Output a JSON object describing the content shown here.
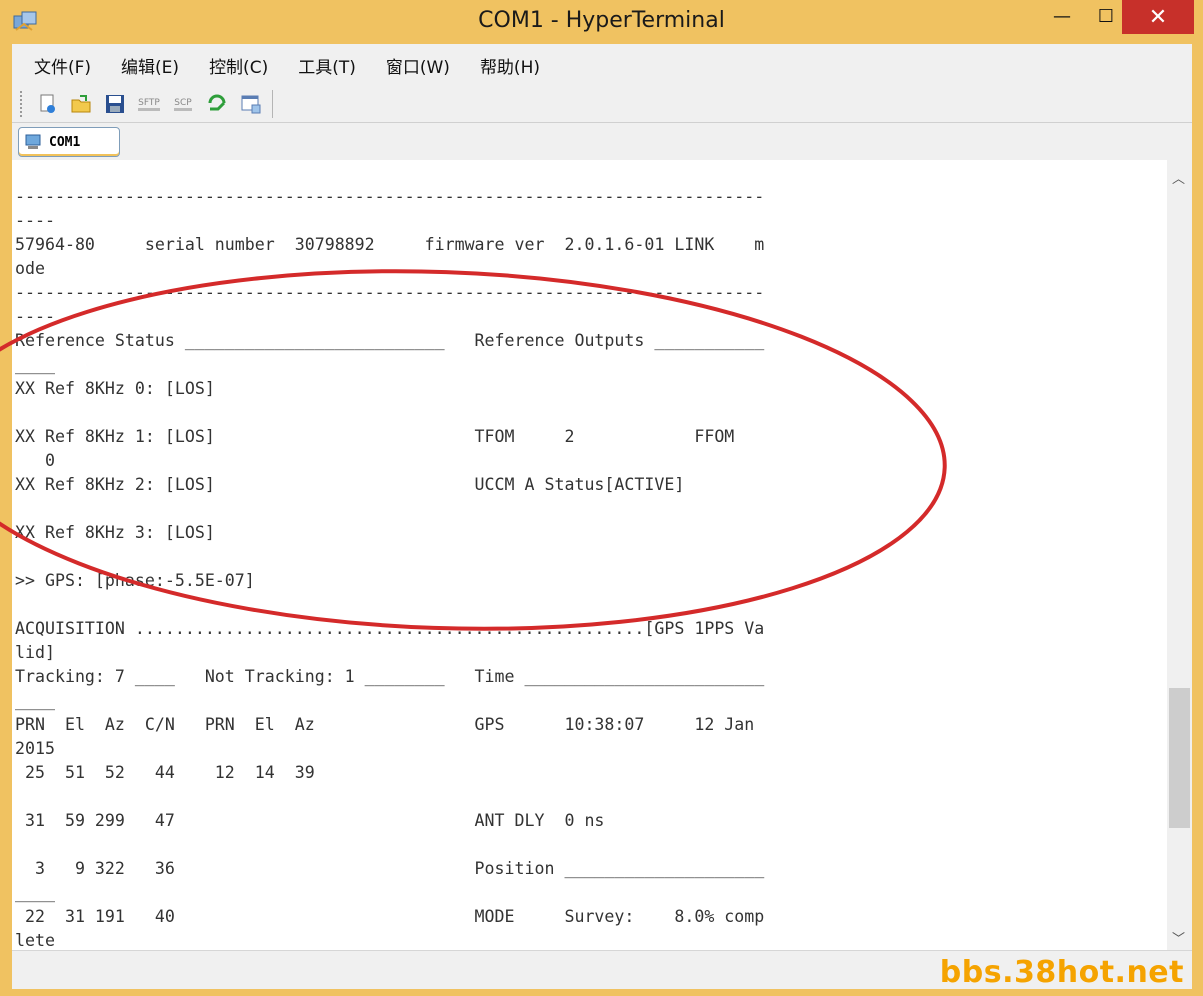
{
  "window": {
    "title": "COM1 - HyperTerminal",
    "minimize_glyph": "—",
    "maximize_glyph": "☐",
    "close_glyph": "✕"
  },
  "menu": [
    {
      "label": "文件(F)"
    },
    {
      "label": "编辑(E)"
    },
    {
      "label": "控制(C)"
    },
    {
      "label": "工具(T)"
    },
    {
      "label": "窗口(W)"
    },
    {
      "label": "帮助(H)"
    }
  ],
  "toolbar": {
    "buttons": [
      {
        "icon": "new-connection-icon"
      },
      {
        "icon": "open-folder-icon"
      },
      {
        "icon": "save-icon"
      },
      {
        "icon": "sftp-icon",
        "label": "SFTP"
      },
      {
        "icon": "scp-icon",
        "label": "SCP"
      },
      {
        "icon": "reconnect-icon"
      },
      {
        "icon": "properties-icon"
      }
    ]
  },
  "session_tab": {
    "label": "COM1",
    "icon": "computer-icon"
  },
  "terminal": {
    "lines": [
      "---------------------------------------------------------------------------",
      "----",
      "57964-80     serial number  30798892     firmware ver  2.0.1.6-01 LINK    m",
      "ode",
      "---------------------------------------------------------------------------",
      "----",
      "Reference Status __________________________   Reference Outputs ___________",
      "____",
      "XX Ref 8KHz 0: [LOS]",
      "",
      "XX Ref 8KHz 1: [LOS]                          TFOM     2            FFOM",
      "   0",
      "XX Ref 8KHz 2: [LOS]                          UCCM A Status[ACTIVE]",
      "",
      "XX Ref 8KHz 3: [LOS]",
      "",
      ">> GPS: [phase:-5.5E-07]",
      "",
      "ACQUISITION ...................................................[GPS 1PPS Va",
      "lid]",
      "Tracking: 7 ____   Not Tracking: 1 ________   Time ________________________",
      "____",
      "PRN  El  Az  C/N   PRN  El  Az                GPS      10:38:07     12 Jan",
      "2015",
      " 25  51  52   44    12  14  39",
      "",
      " 31  59 299   47                              ANT DLY  0 ns",
      "",
      "  3   9 322   36                              Position ____________________",
      "____",
      " 22  31 191   40                              MODE     Survey:    8.0% comp",
      "lete"
    ]
  },
  "scrollbar": {
    "up_glyph": "︿",
    "down_glyph": "﹀",
    "position": 0.78
  },
  "statusbar": {
    "watermark": "bbs.38hot.net"
  },
  "colors": {
    "frame": "#f0c261",
    "close_button": "#c7302a",
    "annotation_ellipse": "#d42a2a",
    "watermark": "#f5a300"
  }
}
